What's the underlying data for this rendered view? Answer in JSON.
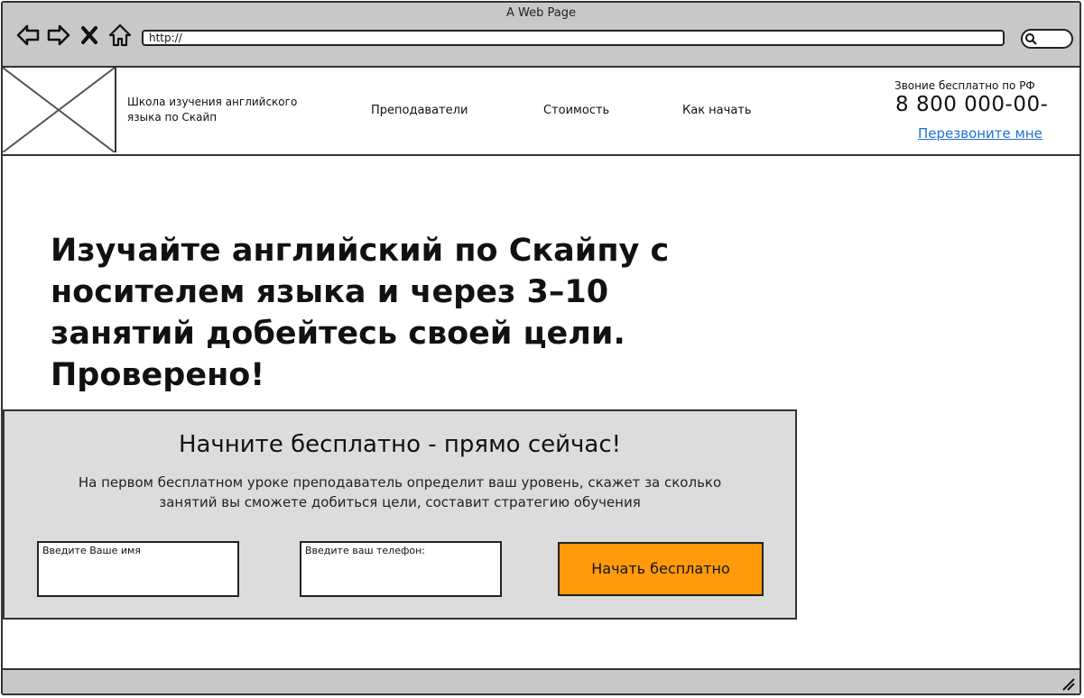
{
  "browser": {
    "title": "A Web Page",
    "url": "http://"
  },
  "header": {
    "brand": "Школа изучения английского языка по Скайп",
    "nav": [
      "Преподаватели",
      "Стоимость",
      "Как начать"
    ],
    "phone_caption": "Звоние бесплатно по РФ",
    "phone": "8 800 000-00-",
    "callback_link": "Перезвоните мне"
  },
  "hero": {
    "headline": "Изучайте английский по Скайпу с носителем языка и через 3–10 занятий добейтесь своей цели. Проверено!"
  },
  "cta": {
    "title": "Начните бесплатно - прямо сейчас!",
    "description": "На первом бесплатном уроке преподаватель определит ваш уровень, скажет за сколько занятий вы сможете добиться цели, составит стратегию обучения",
    "name_placeholder": "Введите Ваше имя",
    "phone_placeholder": "Введите ваш телефон:",
    "button_label": "Начать бесплатно"
  },
  "colors": {
    "cta_button": "#ff9a0a",
    "panel_bg": "#dcdcdc",
    "chrome_bg": "#c8c8c8",
    "link": "#1e6fd9"
  }
}
